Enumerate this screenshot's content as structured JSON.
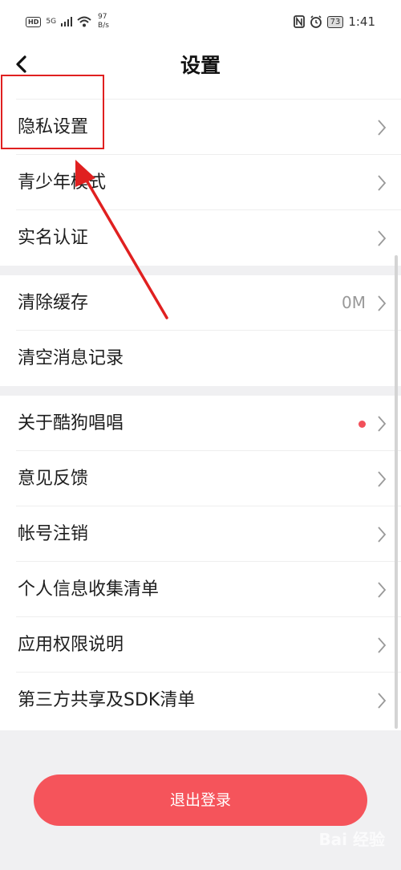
{
  "status_bar": {
    "hd": "HD",
    "signal": "5G",
    "net_speed_value": "97",
    "net_speed_unit": "B/s",
    "battery": "73",
    "time": "1:41"
  },
  "header": {
    "title": "设置"
  },
  "groups": [
    {
      "items": [
        {
          "label": "隐私设置"
        },
        {
          "label": "青少年模式"
        },
        {
          "label": "实名认证"
        }
      ]
    },
    {
      "items": [
        {
          "label": "清除缓存",
          "value": "0M"
        },
        {
          "label": "清空消息记录"
        }
      ]
    },
    {
      "items": [
        {
          "label": "关于酷狗唱唱"
        },
        {
          "label": "意见反馈"
        },
        {
          "label": "帐号注销"
        },
        {
          "label": "个人信息收集清单"
        },
        {
          "label": "应用权限说明"
        },
        {
          "label": "第三方共享及SDK清单"
        }
      ]
    }
  ],
  "logout_button": "退出登录",
  "watermark": "Bai 经验",
  "colors": {
    "accent": "#f5545b",
    "annotation": "#e02020",
    "badge_dot": "#f2505a"
  }
}
